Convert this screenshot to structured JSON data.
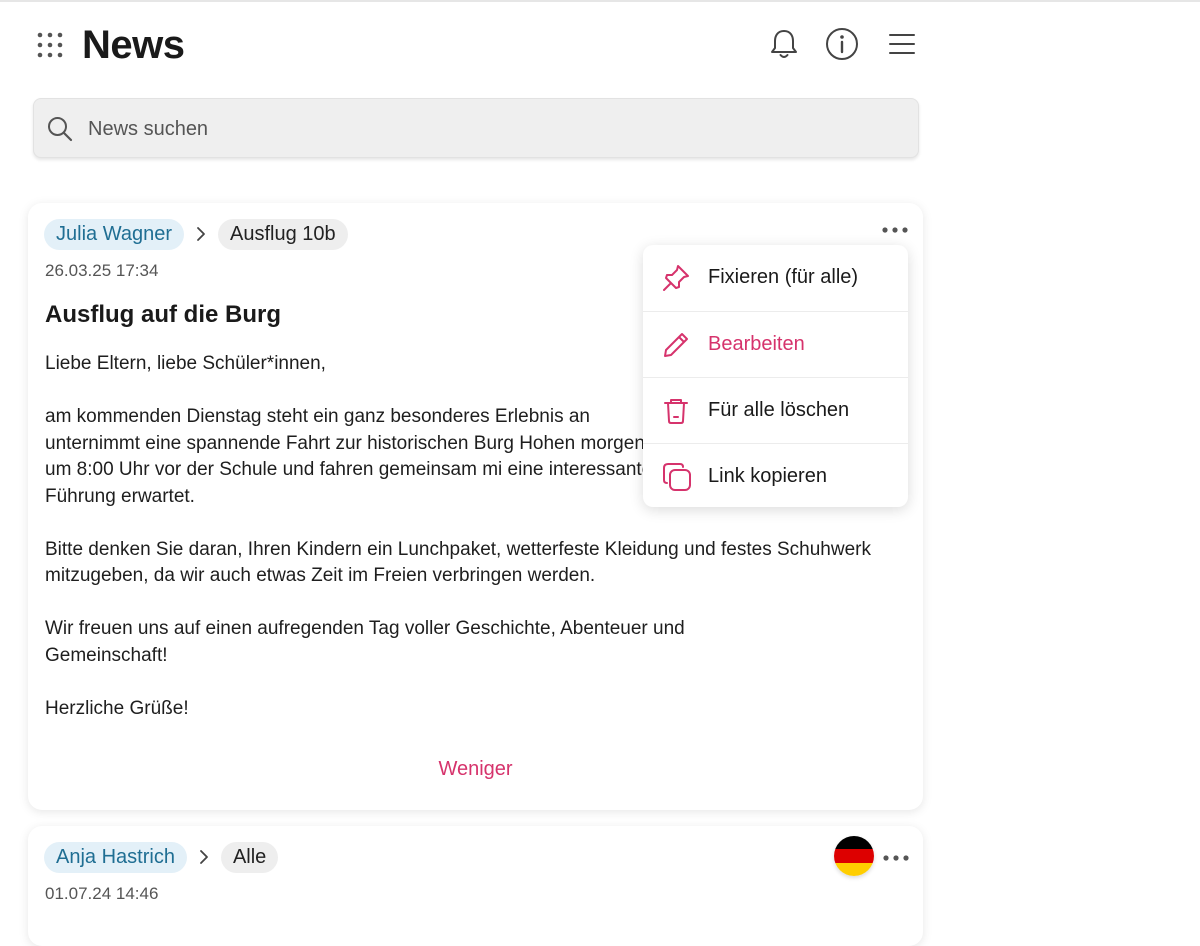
{
  "header": {
    "title": "News",
    "menu_icon": "apps-grid-icon",
    "icons": [
      "bell-icon",
      "info-icon",
      "hamburger-menu-icon"
    ]
  },
  "search": {
    "placeholder": "News suchen",
    "value": ""
  },
  "posts": [
    {
      "author": "Julia Wagner",
      "group": "Ausflug 10b",
      "date": "26.03.25 17:34",
      "title": "Ausflug auf die Burg",
      "paragraphs": [
        "Liebe Eltern, liebe Schüler*innen,",
        "am kommenden Dienstag steht ein ganz besonderes Erlebnis an unternimmt eine spannende Fahrt zur historischen Burg Hohen morgens um 8:00 Uhr vor der Schule und fahren gemeinsam mi eine interessante Führung erwartet.",
        "Bitte denken Sie daran, Ihren Kindern ein Lunchpaket, wetterfeste Kleidung und festes Schuhwerk mitzugeben, da wir auch etwas Zeit im Freien verbringen werden.",
        "Wir freuen uns auf einen aufregenden Tag voller Geschichte, Abenteuer und Gemeinschaft!",
        "Herzliche Grüße!"
      ],
      "less_label": "Weniger"
    },
    {
      "author": "Anja Hastrich",
      "group": "Alle",
      "date": "01.07.24 14:46",
      "language_flag": "flag-germany-icon"
    }
  ],
  "context_menu": {
    "items": [
      {
        "label": "Fixieren (für alle)",
        "icon": "pin-icon"
      },
      {
        "label": "Bearbeiten",
        "icon": "pencil-icon"
      },
      {
        "label": "Für alle löschen",
        "icon": "trash-icon"
      },
      {
        "label": "Link kopieren",
        "icon": "copy-icon"
      }
    ]
  },
  "colors": {
    "accent": "#d6336c",
    "author_chip_bg": "#e3f0f8",
    "author_chip_text": "#1f6e93",
    "search_bg": "#efefef"
  }
}
